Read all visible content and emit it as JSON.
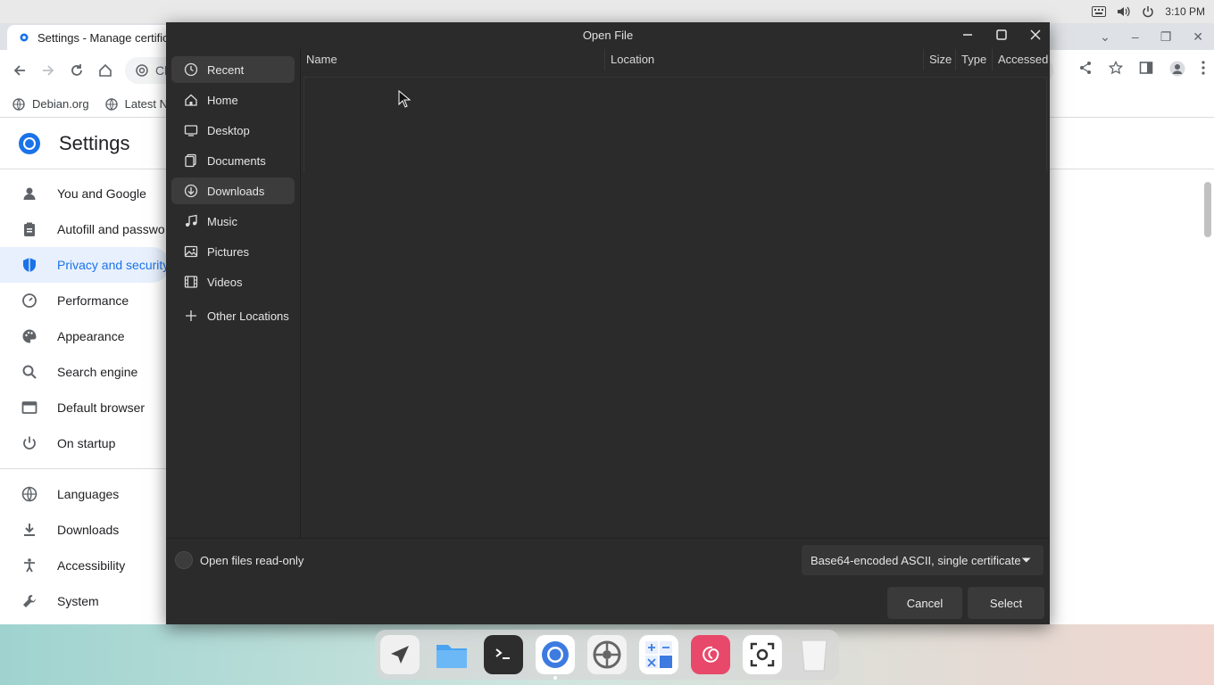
{
  "system": {
    "clock": "3:10 PM"
  },
  "browser": {
    "tab_title": "Settings - Manage certific",
    "omnibox_text": "Cl",
    "bookmarks": [
      "Debian.org",
      "Latest N"
    ],
    "settings_title": "Settings",
    "nav_items": [
      {
        "label": "You and Google",
        "icon": "person-icon"
      },
      {
        "label": "Autofill and passwo",
        "icon": "clipboard-icon"
      },
      {
        "label": "Privacy and security",
        "icon": "shield-icon",
        "active": true
      },
      {
        "label": "Performance",
        "icon": "gauge-icon"
      },
      {
        "label": "Appearance",
        "icon": "palette-icon"
      },
      {
        "label": "Search engine",
        "icon": "search-icon"
      },
      {
        "label": "Default browser",
        "icon": "browser-icon"
      },
      {
        "label": "On startup",
        "icon": "power-icon"
      },
      {
        "label": "Languages",
        "icon": "globe-icon"
      },
      {
        "label": "Downloads",
        "icon": "download-icon"
      },
      {
        "label": "Accessibility",
        "icon": "accessibility-icon"
      },
      {
        "label": "System",
        "icon": "wrench-icon"
      }
    ],
    "accent_color": "#1a73e8"
  },
  "dialog": {
    "title": "Open File",
    "places": [
      {
        "label": "Recent",
        "icon": "clock-icon",
        "selected": true
      },
      {
        "label": "Home",
        "icon": "home-icon"
      },
      {
        "label": "Desktop",
        "icon": "desktop-icon"
      },
      {
        "label": "Documents",
        "icon": "documents-icon"
      },
      {
        "label": "Downloads",
        "icon": "download-icon",
        "selected": true
      },
      {
        "label": "Music",
        "icon": "music-icon"
      },
      {
        "label": "Pictures",
        "icon": "picture-icon"
      },
      {
        "label": "Videos",
        "icon": "film-icon"
      },
      {
        "label": "Other Locations",
        "icon": "plus-icon"
      }
    ],
    "columns": [
      "Name",
      "Location",
      "Size",
      "Type",
      "Accessed"
    ],
    "readonly_label": "Open files read-only",
    "filter_value": "Base64-encoded ASCII, single certificate",
    "cancel_label": "Cancel",
    "select_label": "Select"
  },
  "dock": {
    "apps": [
      "launcher-icon",
      "files-icon",
      "terminal-icon",
      "chrome-icon",
      "settings-icon",
      "calculator-icon",
      "debian-icon",
      "screenshot-icon",
      "trash-icon"
    ]
  }
}
